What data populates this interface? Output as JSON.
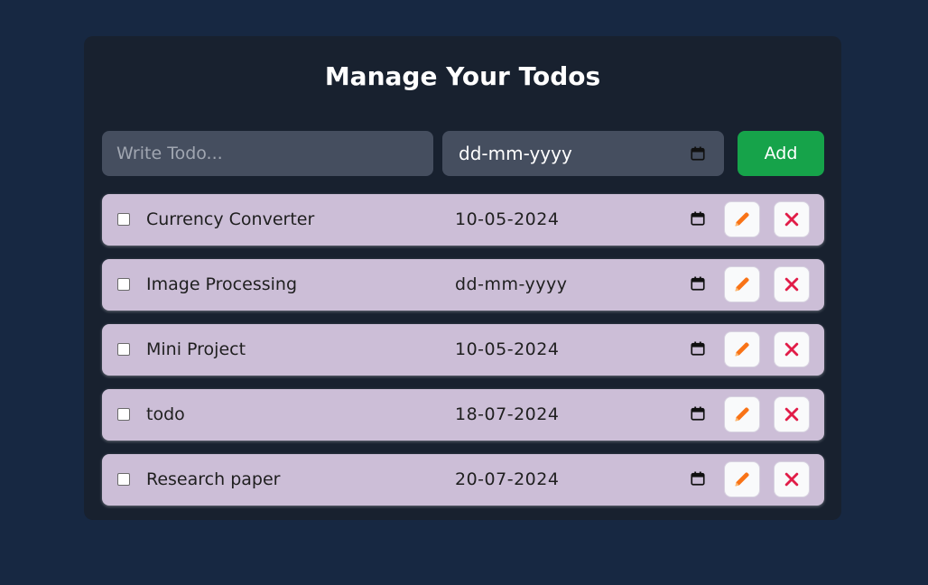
{
  "title": "Manage Your Todos",
  "form": {
    "todo_placeholder": "Write Todo...",
    "date_value": "dd-mm-yyyy",
    "add_label": "Add"
  },
  "todos": [
    {
      "text": "Currency Converter",
      "date": "10-05-2024",
      "completed": false
    },
    {
      "text": "Image Processing",
      "date": "dd-mm-yyyy",
      "completed": false
    },
    {
      "text": "Mini Project",
      "date": "10-05-2024",
      "completed": false
    },
    {
      "text": "todo",
      "date": "18-07-2024",
      "completed": false
    },
    {
      "text": "Research paper",
      "date": "20-07-2024",
      "completed": false
    }
  ],
  "colors": {
    "page_bg": "#172842",
    "card_bg": "#18212f",
    "row_bg": "#ccbed7",
    "add_button": "#16a34a",
    "edit_icon": "#f97316",
    "delete_icon": "#e11d48"
  },
  "icons": {
    "calendar": "calendar-icon",
    "edit": "pencil-icon",
    "delete": "close-icon"
  }
}
